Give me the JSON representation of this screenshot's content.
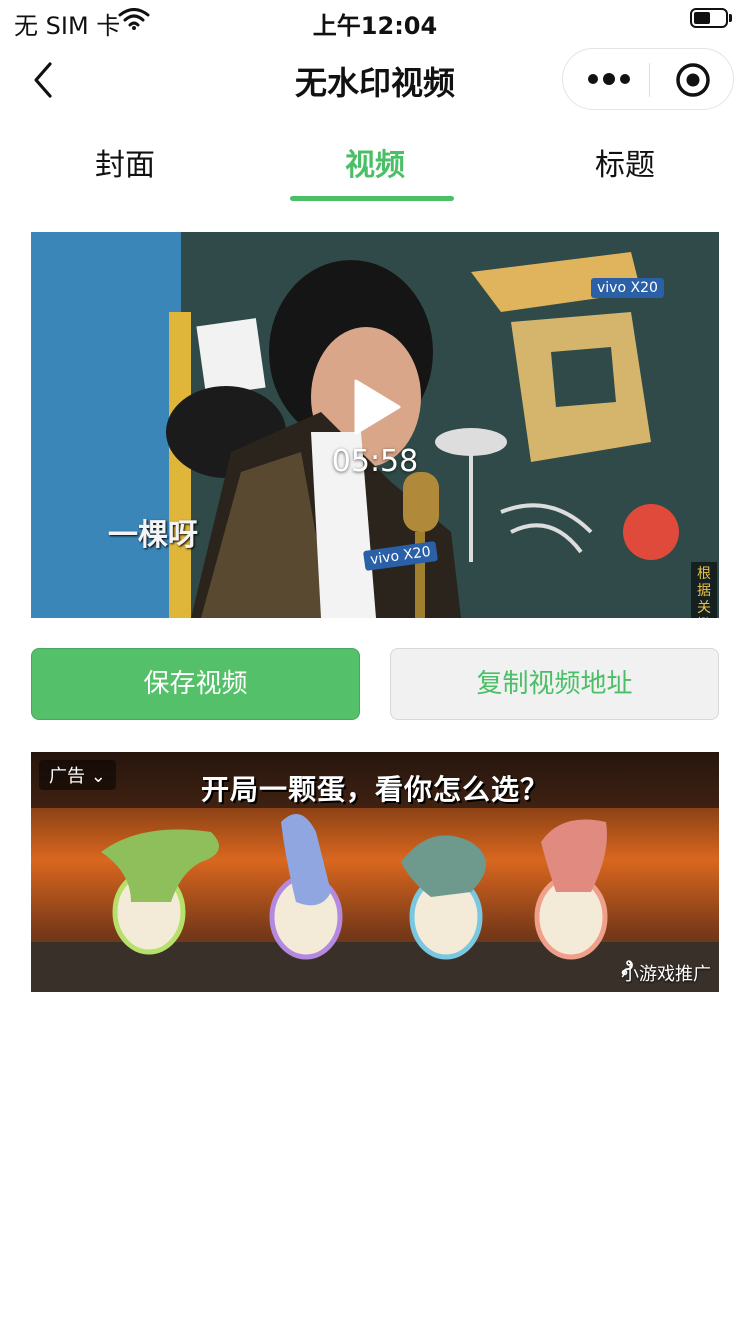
{
  "status_bar": {
    "carrier": "无 SIM 卡",
    "time": "上午12:04",
    "battery_level": 0.45
  },
  "nav": {
    "title": "无水印视频"
  },
  "tabs": [
    {
      "label": "封面",
      "active": false
    },
    {
      "label": "视频",
      "active": true
    },
    {
      "label": "标题",
      "active": false
    }
  ],
  "video": {
    "duration": "05:58",
    "subtitle": "一棵呀",
    "brand_top": "vivo X20",
    "brand_mic": "vivo X20",
    "side_caption": "根据关键词「白色」接歌"
  },
  "actions": {
    "save_label": "保存视频",
    "copy_label": "复制视频地址"
  },
  "ad": {
    "tag": "广告",
    "headline": "开局一颗蛋，看你怎么选？",
    "source": "小游戏推广"
  },
  "colors": {
    "accent": "#4bbf66",
    "save_button": "#55c06a",
    "copy_button_bg": "#f1f1f1"
  }
}
